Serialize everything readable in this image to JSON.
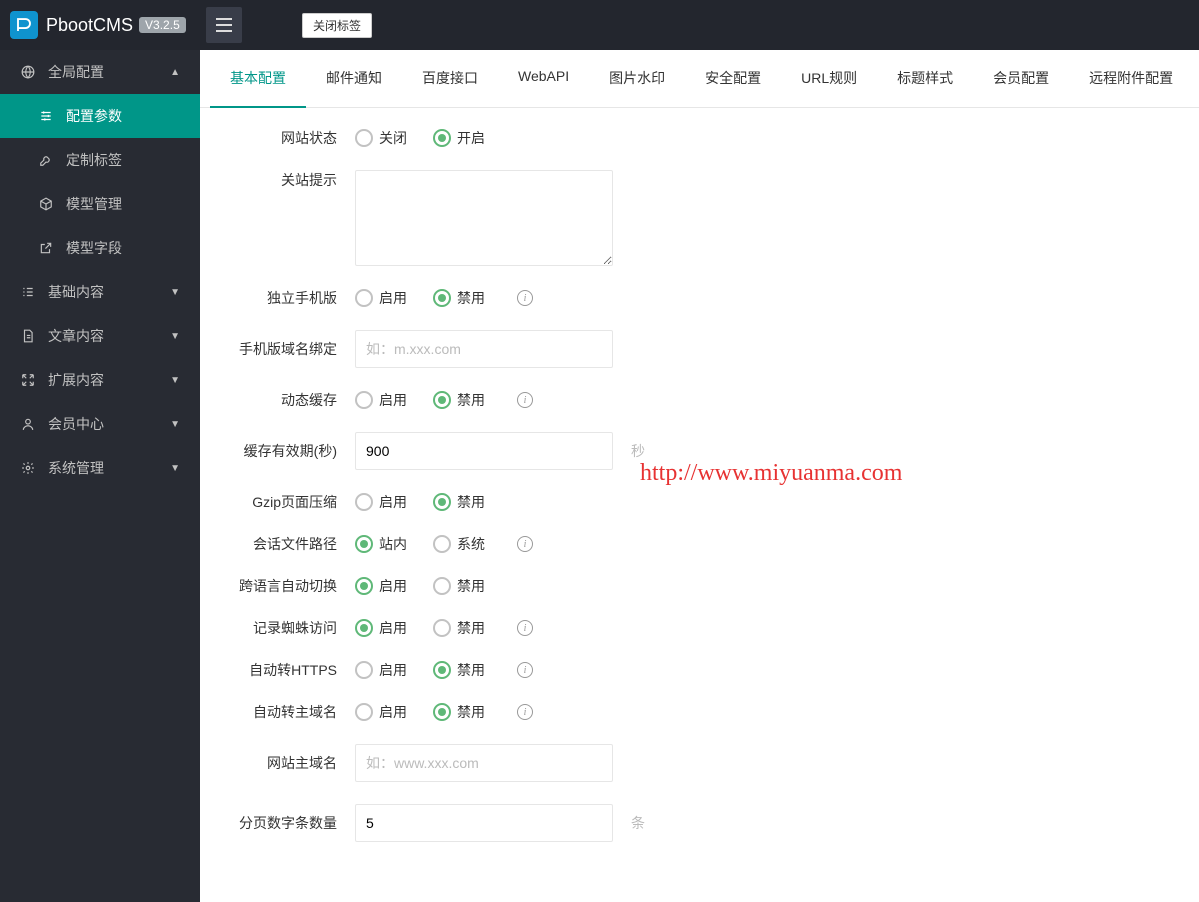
{
  "header": {
    "brand": "PbootCMS",
    "version": "V3.2.5",
    "close_tabs": "关闭标签"
  },
  "sidebar": {
    "global": {
      "label": "全局配置",
      "icon": "globe"
    },
    "global_sub": [
      {
        "label": "配置参数",
        "icon": "sliders",
        "active": true
      },
      {
        "label": "定制标签",
        "icon": "wrench",
        "active": false
      },
      {
        "label": "模型管理",
        "icon": "cube",
        "active": false
      },
      {
        "label": "模型字段",
        "icon": "external",
        "active": false
      }
    ],
    "menus": [
      {
        "label": "基础内容",
        "icon": "list"
      },
      {
        "label": "文章内容",
        "icon": "doc"
      },
      {
        "label": "扩展内容",
        "icon": "expand"
      },
      {
        "label": "会员中心",
        "icon": "user"
      },
      {
        "label": "系统管理",
        "icon": "gear"
      }
    ]
  },
  "tabs": [
    "基本配置",
    "邮件通知",
    "百度接口",
    "WebAPI",
    "图片水印",
    "安全配置",
    "URL规则",
    "标题样式",
    "会员配置",
    "远程附件配置"
  ],
  "form": {
    "site_status": {
      "label": "网站状态",
      "opt_close": "关闭",
      "opt_open": "开启",
      "value": "open"
    },
    "close_hint": {
      "label": "关站提示",
      "value": ""
    },
    "mobile_ver": {
      "label": "独立手机版",
      "opt_enable": "启用",
      "opt_disable": "禁用",
      "value": "disable"
    },
    "mobile_domain": {
      "label": "手机版域名绑定",
      "placeholder": "如：m.xxx.com",
      "value": ""
    },
    "dynamic_cache": {
      "label": "动态缓存",
      "opt_enable": "启用",
      "opt_disable": "禁用",
      "value": "disable"
    },
    "cache_expire": {
      "label": "缓存有效期(秒)",
      "value": "900",
      "suffix": "秒"
    },
    "gzip": {
      "label": "Gzip页面压缩",
      "opt_enable": "启用",
      "opt_disable": "禁用",
      "value": "disable"
    },
    "session_path": {
      "label": "会话文件路径",
      "opt_site": "站内",
      "opt_system": "系统",
      "value": "site"
    },
    "auto_lang": {
      "label": "跨语言自动切换",
      "opt_enable": "启用",
      "opt_disable": "禁用",
      "value": "enable"
    },
    "spider_log": {
      "label": "记录蜘蛛访问",
      "opt_enable": "启用",
      "opt_disable": "禁用",
      "value": "enable"
    },
    "auto_https": {
      "label": "自动转HTTPS",
      "opt_enable": "启用",
      "opt_disable": "禁用",
      "value": "disable"
    },
    "auto_main_domain": {
      "label": "自动转主域名",
      "opt_enable": "启用",
      "opt_disable": "禁用",
      "value": "disable"
    },
    "main_domain": {
      "label": "网站主域名",
      "placeholder": "如：www.xxx.com",
      "value": ""
    },
    "page_num_count": {
      "label": "分页数字条数量",
      "value": "5",
      "suffix": "条"
    }
  },
  "watermark": "http://www.miyuanma.com"
}
